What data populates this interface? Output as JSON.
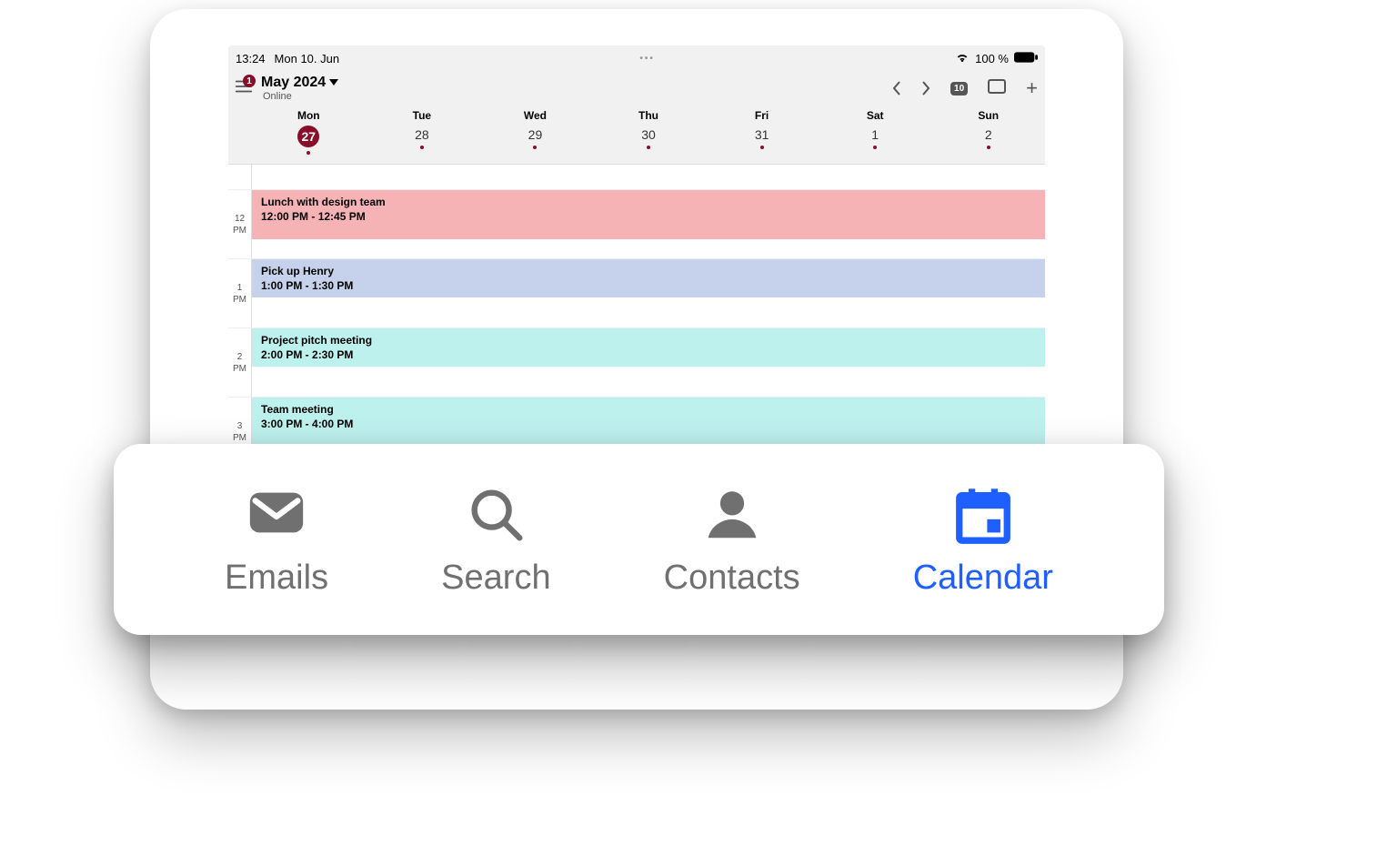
{
  "statusbar": {
    "time": "13:24",
    "date": "Mon 10. Jun",
    "battery": "100 %"
  },
  "header": {
    "menu_badge": "1",
    "month": "May 2024",
    "status": "Online",
    "day_badge": "10"
  },
  "week": {
    "days": [
      {
        "name": "Mon",
        "num": "27",
        "selected": true
      },
      {
        "name": "Tue",
        "num": "28",
        "selected": false
      },
      {
        "name": "Wed",
        "num": "29",
        "selected": false
      },
      {
        "name": "Thu",
        "num": "30",
        "selected": false
      },
      {
        "name": "Fri",
        "num": "31",
        "selected": false
      },
      {
        "name": "Sat",
        "num": "1",
        "selected": false
      },
      {
        "name": "Sun",
        "num": "2",
        "selected": false
      }
    ]
  },
  "hours": {
    "h12_a": "12",
    "h12_b": "PM",
    "h1_a": "1",
    "h1_b": "PM",
    "h2_a": "2",
    "h2_b": "PM",
    "h3_a": "3",
    "h3_b": "PM"
  },
  "events": {
    "e1_title": "Lunch with design team",
    "e1_time": "12:00 PM - 12:45 PM",
    "e2_title": "Pick up Henry",
    "e2_time": "1:00 PM - 1:30 PM",
    "e3_title": "Project pitch meeting",
    "e3_time": "2:00 PM - 2:30 PM",
    "e4_title": "Team meeting",
    "e4_time": "3:00 PM - 4:00 PM"
  },
  "tabs": {
    "emails": "Emails",
    "search": "Search",
    "contacts": "Contacts",
    "calendar": "Calendar"
  }
}
